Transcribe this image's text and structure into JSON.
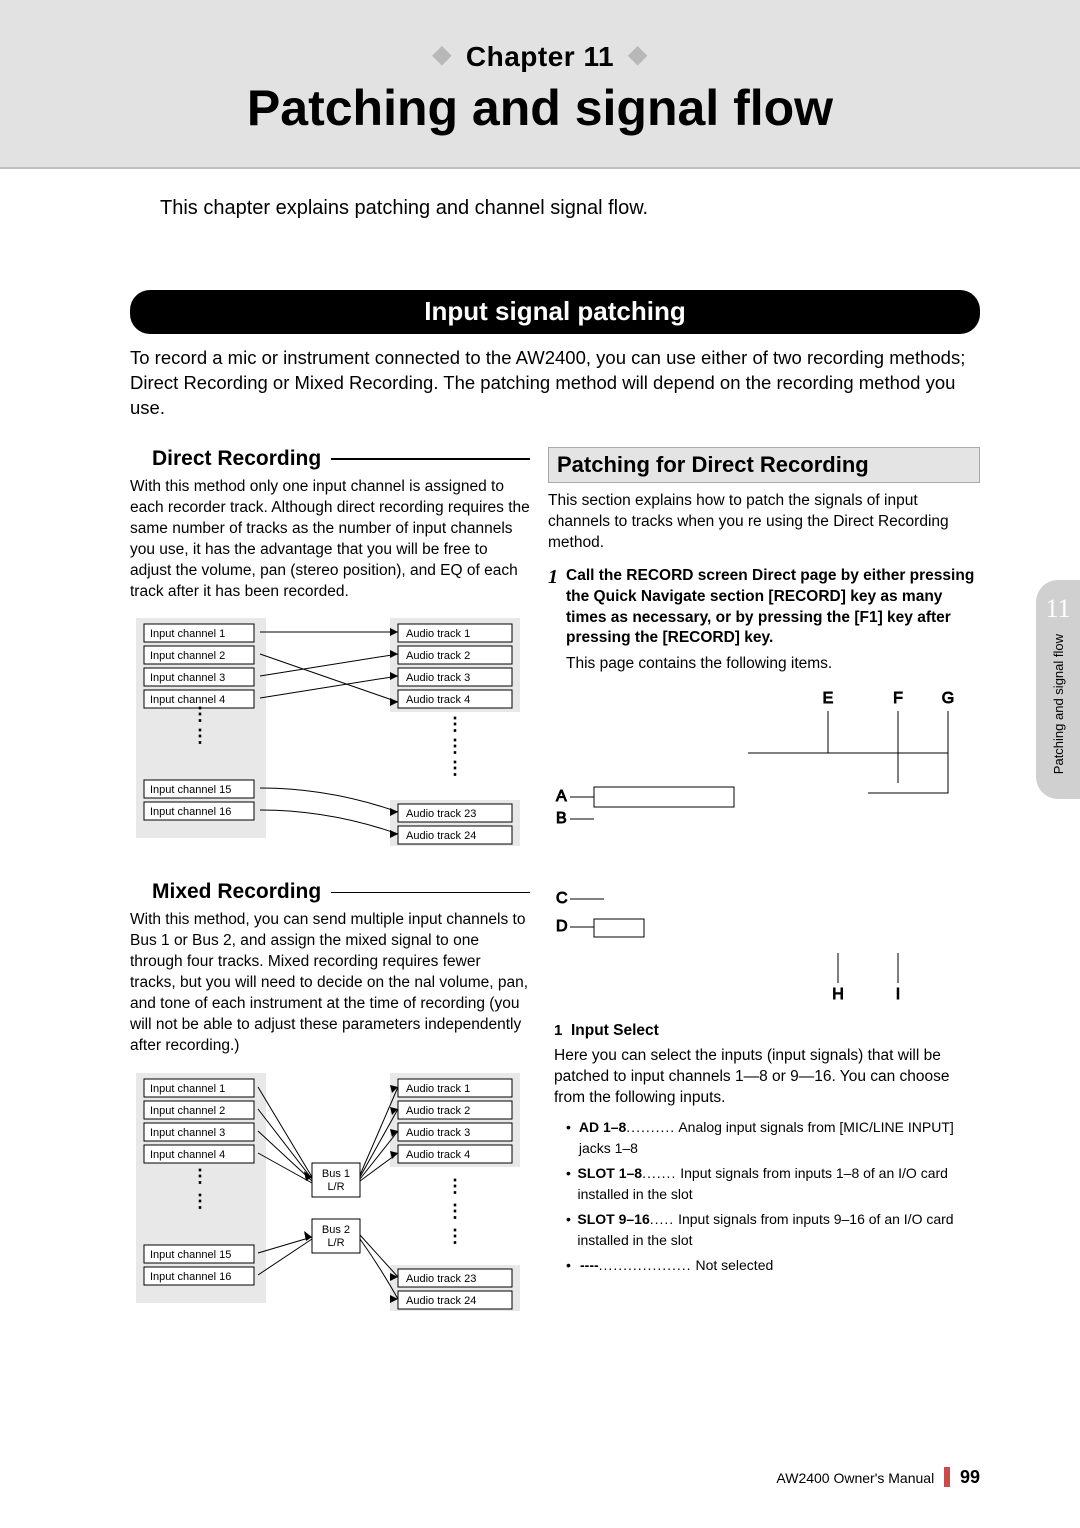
{
  "chapter": {
    "prefix": "Chapter 11",
    "title": "Patching and signal flow"
  },
  "intro": "This chapter explains patching and channel signal flow.",
  "section_bar": "Input signal patching",
  "section_intro": "To record a mic or instrument connected to the AW2400, you can use either of two recording methods; Direct Recording or Mixed Recording. The patching method will depend on the recording method you use.",
  "direct": {
    "heading": "Direct Recording",
    "body": "With this method only one input channel is assigned to each recorder track. Although direct recording requires the same number of tracks as the number of input channels you use, it has the advantage that you will be free to adjust the volume, pan (stereo position), and EQ of each track after it has been recorded.",
    "labels": {
      "in": [
        "Input channel 1",
        "Input channel 2",
        "Input channel 3",
        "Input channel 4",
        "Input channel 15",
        "Input channel 16"
      ],
      "out": [
        "Audio track 1",
        "Audio track 2",
        "Audio track 3",
        "Audio track 4",
        "Audio track 23",
        "Audio track 24"
      ]
    }
  },
  "mixed": {
    "heading": "Mixed Recording",
    "body": "With this method, you can send multiple input channels to Bus 1 or Bus 2, and assign the mixed signal to one through four tracks. Mixed recording requires fewer tracks, but you will need to decide on the nal volume, pan, and tone of each instrument at the time of recording (you will not be able to adjust these parameters independently after recording.)",
    "bus": [
      "Bus 1\nL/R",
      "Bus 2\nL/R"
    ],
    "labels": {
      "in": [
        "Input channel 1",
        "Input channel 2",
        "Input channel 3",
        "Input channel 4",
        "Input channel 15",
        "Input channel 16"
      ],
      "out": [
        "Audio track 1",
        "Audio track 2",
        "Audio track 3",
        "Audio track 4",
        "Audio track 23",
        "Audio track 24"
      ]
    }
  },
  "patch_direct": {
    "heading": "Patching for Direct Recording",
    "intro": "This section explains how to patch the signals of input channels to tracks when you re using the Direct Recording method.",
    "step_num": "1",
    "step_bold": "Call the RECORD screen Direct page by either pressing the Quick Navigate section [RECORD] key as many times as necessary, or by pressing the [F1] key after pressing the [RECORD] key.",
    "step_follow": "This page contains the following items.",
    "callouts": [
      "A",
      "B",
      "C",
      "D",
      "E",
      "F",
      "G",
      "H",
      "I"
    ],
    "input_select": {
      "num": "1",
      "title": "Input Select",
      "body": "Here you can select the inputs (input signals) that will be patched to input channels 1―8 or 9―16. You can choose from the following inputs.",
      "items": [
        {
          "label": "AD 1–8",
          "dots": "..........",
          "desc": "Analog input signals from [MIC/LINE INPUT] jacks 1–8"
        },
        {
          "label": "SLOT 1–8",
          "dots": ".......",
          "desc": "Input signals from inputs 1–8 of an I/O card installed in the slot"
        },
        {
          "label": "SLOT 9–16",
          "dots": ".....",
          "desc": "Input signals from inputs 9–16 of an I/O card installed in the slot"
        },
        {
          "label": "----",
          "dots": "...................",
          "desc": "Not selected"
        }
      ]
    }
  },
  "side_tab": {
    "num": "11",
    "text": "Patching and signal flow"
  },
  "footer": {
    "product": "AW2400  Owner's Manual",
    "page": "99"
  }
}
